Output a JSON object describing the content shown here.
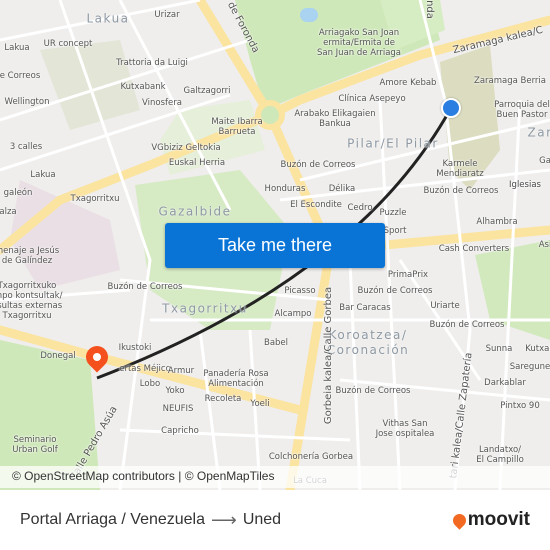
{
  "map": {
    "districts": [
      "Lakua",
      "Gazalbide",
      "Pilar/El Pilar",
      "Txagorritxu",
      "Koroatzea/\nCoronación",
      "Zar"
    ],
    "streets": [
      "de Foronda",
      "nda",
      "Zaramaga kalea/C",
      "Gorbeia kalea/Calle Gorbea",
      "tari kalea/Calle Zapatería",
      "Calle Pedro Asúa"
    ],
    "places": [
      "Urizar",
      "Lakua",
      "UR concept",
      "Trattoria da Luigi",
      "e Correos",
      "Wellington",
      "Kutxabank",
      "Galtzagorri",
      "Vinosfera",
      "Maite Ibarra\nBarrueta",
      "3 calles",
      "VGbiziz Geltokia",
      "Euskal Herria",
      "Lakua",
      "galeón",
      "Txagorritxu",
      "alza",
      "Arriagako San Joan\nermita/Ermita de\nSan Juan de Arriaga",
      "Amore Kebab",
      "Zaramaga Berria",
      "Clínica Asepeyo",
      "Arabako Elikagaien\nBankua",
      "Parroquia del\nBuen Pastor",
      "Buzón de Correos",
      "Karmele\nMendiaratz",
      "Honduras",
      "Délika",
      "Buzón de Correos",
      "Iglesias",
      "El Escondite",
      "Cedro",
      "Puzzle",
      "Alhambra",
      "Sport",
      "menaje a Jesús\nde Galíndez",
      "Txagorritxuko\nanpo kontsultak/\nnsultas externas\nTxagorritxu",
      "Buzón de Correos",
      "Ikustoki",
      "Donegal",
      "ertas Méjico",
      "Armur",
      "Lobo",
      "Panadería Rosa\nAlimentación",
      "Yoko",
      "Recoleta",
      "Yoeli",
      "NEUFIS",
      "Capricho",
      "Seminario\nUrban Golf",
      "Cash Converters",
      "PrimaPrix",
      "Picasso",
      "Buzón de Correos",
      "Alcampo",
      "Bar Caracas",
      "Uriarte",
      "Babel",
      "Buzón de Correos",
      "Sunna",
      "Kutxab",
      "Saregune",
      "Darkablar",
      "Buzón de Correos",
      "Pintxo 90",
      "Vithas San\nJose ospitalea",
      "Landatxo/\nEl Campillo",
      "Colchonería Gorbea",
      "La Cuca",
      "Ga",
      "Iglesias",
      "Asi"
    ],
    "origin_color": "#2a7de1",
    "destination_color": "#f4511e",
    "route_color": "#222222"
  },
  "cta": {
    "label": "Take me there",
    "color": "#0a74d6"
  },
  "attribution": "© OpenStreetMap contributors | © OpenMapTiles",
  "footer": {
    "origin": "Portal Arriaga / Venezuela",
    "arrow": "⟶",
    "destination": "Uned",
    "brand": "moovit",
    "brand_color": "#f26a21"
  }
}
